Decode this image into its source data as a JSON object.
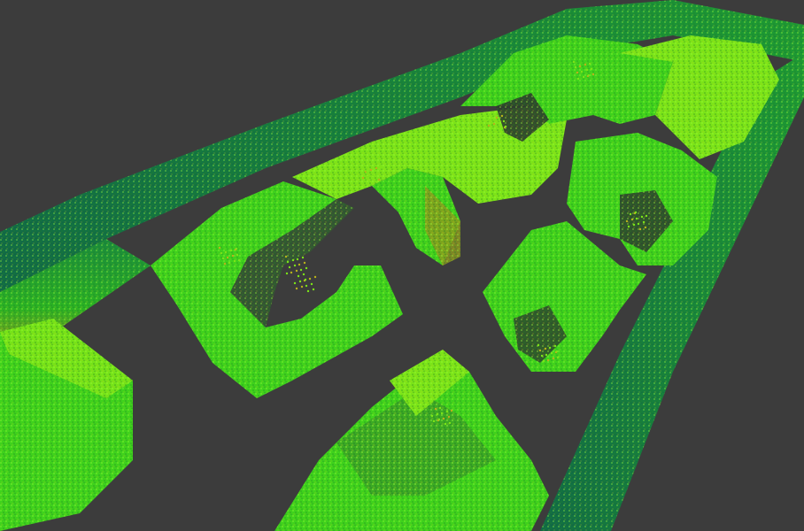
{
  "view": {
    "background": "#3c3c3c",
    "colormap": [
      "#0f6b53",
      "#1c9a3a",
      "#3fd21c",
      "#7ce418",
      "#b9b11c"
    ],
    "point_density": "high"
  }
}
